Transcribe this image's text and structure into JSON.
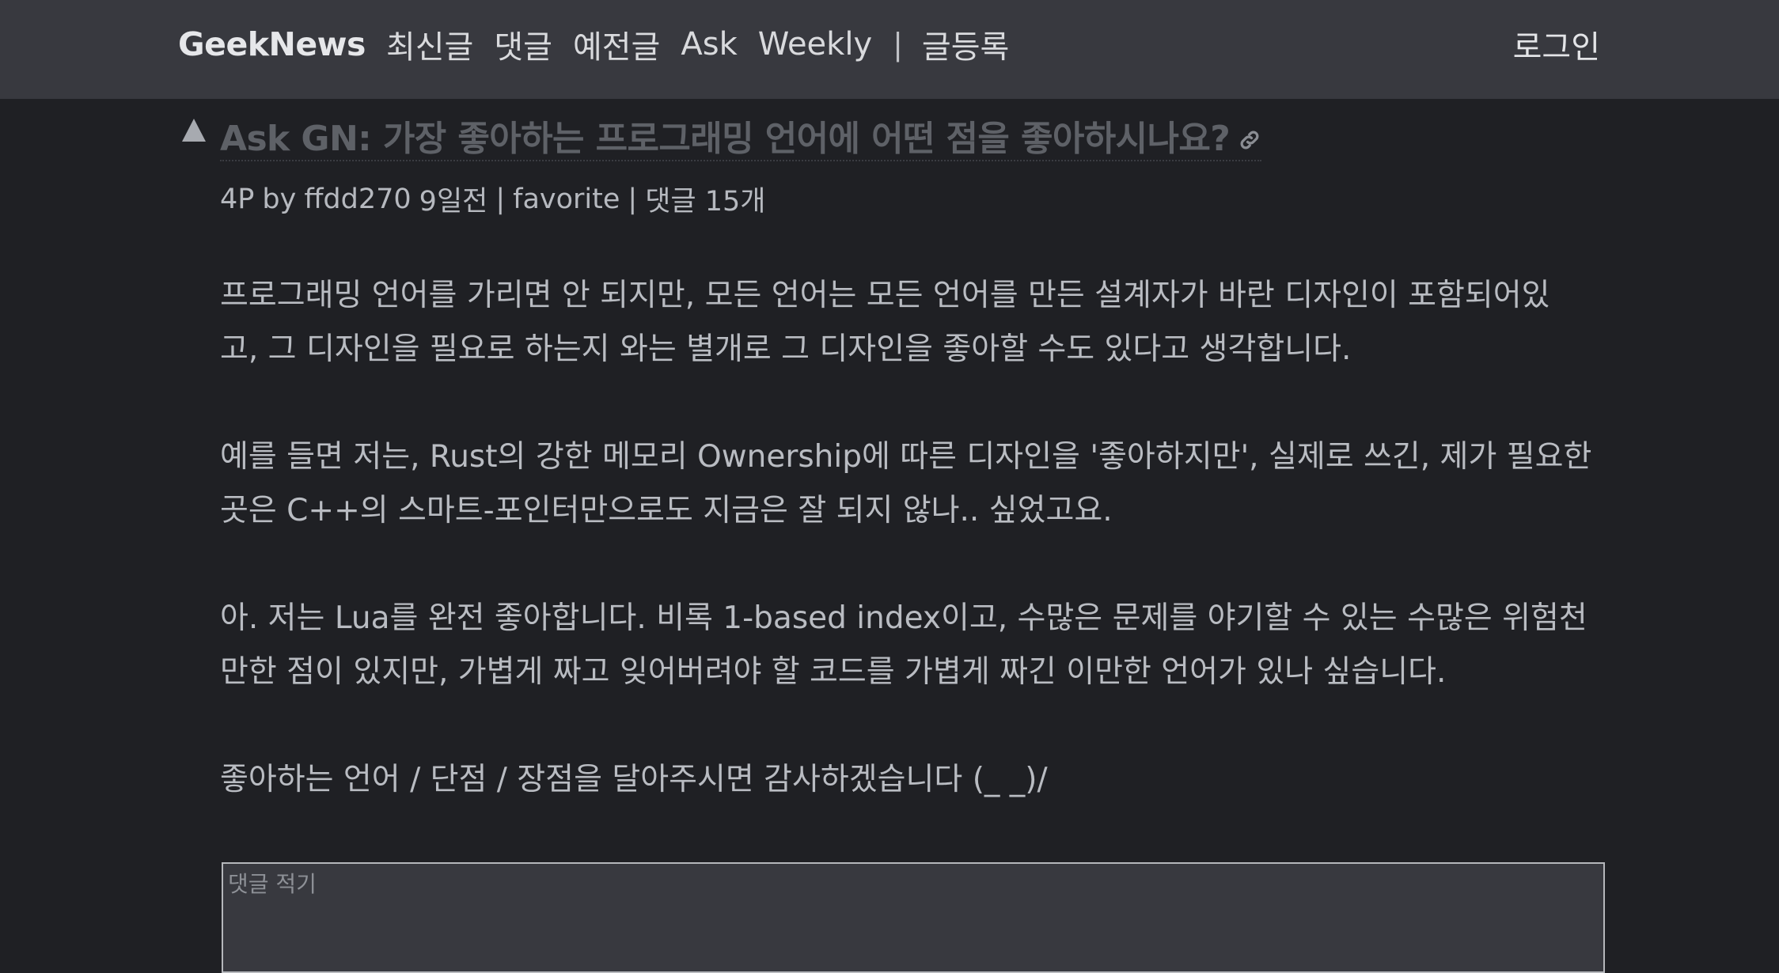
{
  "nav": {
    "brand": "GeekNews",
    "links": [
      "최신글",
      "댓글",
      "예전글",
      "Ask",
      "Weekly"
    ],
    "separator": "|",
    "submit": "글등록",
    "login": "로그인"
  },
  "post": {
    "title": "Ask GN: 가장 좋아하는 프로그래밍 언어에 어떤 점을 좋아하시나요?",
    "meta": {
      "points": "4P",
      "by": "by",
      "author": "ffdd270",
      "time": "9일전",
      "sep": "|",
      "favorite": "favorite",
      "comments": "댓글 15개"
    },
    "body": [
      [
        "프로그래밍 언어를 가리면 안 되지만, 모든 언어는 모든 언어를 만든 설계자가 바란 디자인이 포함되어있",
        "고, 그 디자인을 필요로 하는지 와는 별개로 그 디자인을 좋아할 수도 있다고 생각합니다."
      ],
      [
        "예를 들면 저는, Rust의 강한 메모리 Ownership에 따른 디자인을 '좋아하지만', 실제로 쓰긴, 제가 필요한",
        "곳은 C++의 스마트-포인터만으로도 지금은 잘 되지 않나.. 싶었고요."
      ],
      [
        "아. 저는 Lua를 완전 좋아합니다. 비록 1-based index이고, 수많은 문제를 야기할 수 있는 수많은 위험천",
        "만한 점이 있지만, 가볍게 짜고 잊어버려야 할 코드를 가볍게 짜긴 이만한 언어가 있나 싶습니다."
      ],
      [
        "좋아하는 언어 / 단점 / 장점을 달아주시면 감사하겠습니다 (_ _)/"
      ]
    ]
  },
  "comment": {
    "placeholder": "댓글 적기"
  },
  "icons": {
    "vote": "upvote-triangle-icon",
    "link": "link-icon"
  },
  "colors": {
    "header_bg": "#38393f",
    "page_bg": "#1f2024",
    "title": "#5e6167",
    "text": "#b9bcc2"
  }
}
